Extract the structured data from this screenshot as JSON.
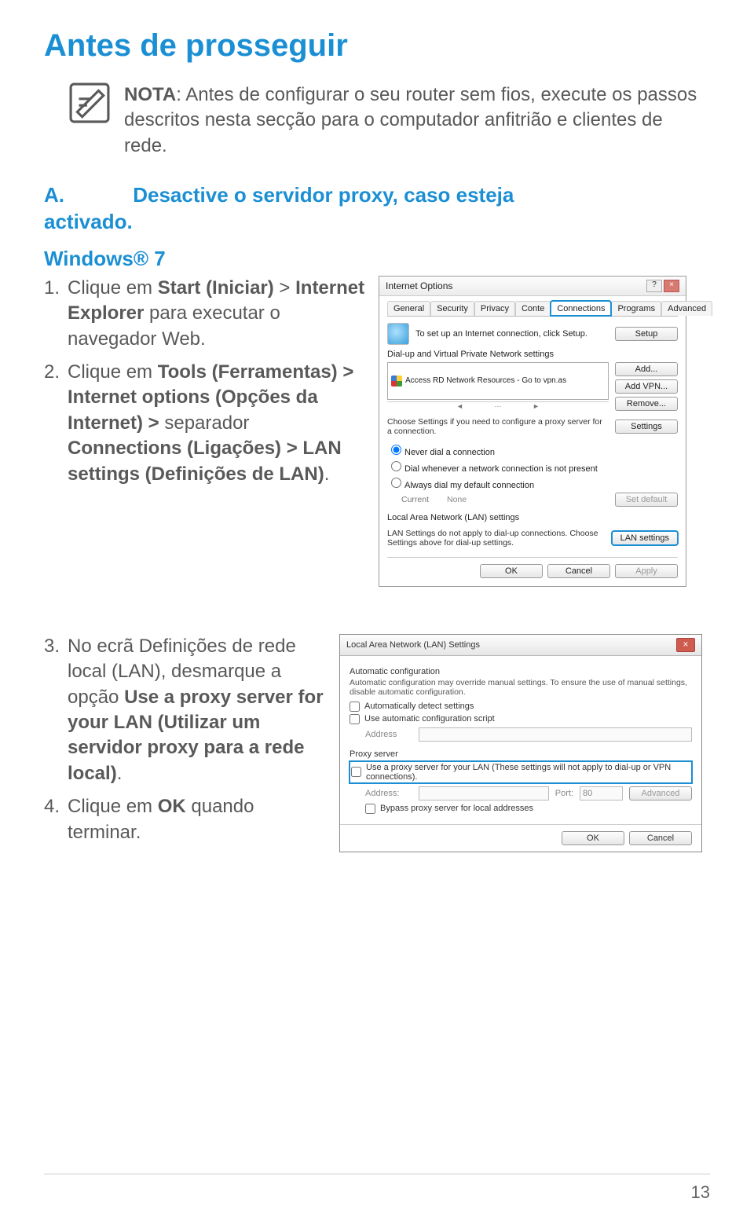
{
  "heading": "Antes de prosseguir",
  "note": {
    "label": "NOTA",
    "text": ":  Antes de configurar o seu router sem fios, execute os passos descritos nesta secção para o computador anfitrião e clientes de rede."
  },
  "sectionA": {
    "letter": "A.",
    "rest": "Desactive o servidor proxy, caso esteja",
    "line2": "activado."
  },
  "subheading": "Windows® 7",
  "steps1": [
    {
      "num": "1.",
      "html": "Clique em <b>Start (Iniciar)</b> > <b>Internet Explorer</b> para executar o navegador Web."
    },
    {
      "num": "2.",
      "html": "Clique em <b>Tools (Ferramentas) > Internet options (Opções da Internet) ></b> separador <b>Connections (Ligações) > LAN settings (Definições de LAN)</b>."
    }
  ],
  "steps2": [
    {
      "num": "3.",
      "html": "No ecrã Definições de rede local (LAN), desmarque a opção <b>Use a proxy server for your LAN (Utilizar um servidor proxy para a rede local)</b>."
    },
    {
      "num": "4.",
      "html": "Clique em <b>OK</b> quando terminar."
    }
  ],
  "io_dialog": {
    "title": "Internet Options",
    "tabs": [
      "General",
      "Security",
      "Privacy",
      "Conte",
      "Connections",
      "Programs",
      "Advanced"
    ],
    "setup_text": "To set up an Internet connection, click Setup.",
    "setup_btn": "Setup",
    "dial_label": "Dial-up and Virtual Private Network settings",
    "vpn_item": "Access RD Network Resources - Go to vpn.as",
    "btn_add": "Add...",
    "btn_addvpn": "Add VPN...",
    "btn_remove": "Remove...",
    "proxy_note": "Choose Settings if you need to configure a proxy server for a connection.",
    "btn_settings": "Settings",
    "radio_never": "Never dial a connection",
    "radio_when": "Dial whenever a network connection is not present",
    "radio_always": "Always dial my default connection",
    "current_lbl": "Current",
    "current_val": "None",
    "btn_setdefault": "Set default",
    "lan_label": "Local Area Network (LAN) settings",
    "lan_note": "LAN Settings do not apply to dial-up connections. Choose Settings above for dial-up settings.",
    "btn_lan": "LAN settings",
    "btn_ok": "OK",
    "btn_cancel": "Cancel",
    "btn_apply": "Apply"
  },
  "lan_dialog": {
    "title": "Local Area Network (LAN) Settings",
    "auto_label": "Automatic configuration",
    "auto_sub": "Automatic configuration may override manual settings. To ensure the use of manual settings, disable automatic configuration.",
    "chk_autodetect": "Automatically detect settings",
    "chk_autoscript": "Use automatic configuration script",
    "addr_lbl": "Address",
    "proxy_label": "Proxy server",
    "chk_proxy": "Use a proxy server for your LAN (These settings will not apply to dial-up or VPN connections).",
    "addr2_lbl": "Address:",
    "port_lbl": "Port:",
    "port_val": "80",
    "btn_adv": "Advanced",
    "chk_bypass": "Bypass proxy server for local addresses",
    "btn_ok": "OK",
    "btn_cancel": "Cancel"
  },
  "page_number": "13"
}
